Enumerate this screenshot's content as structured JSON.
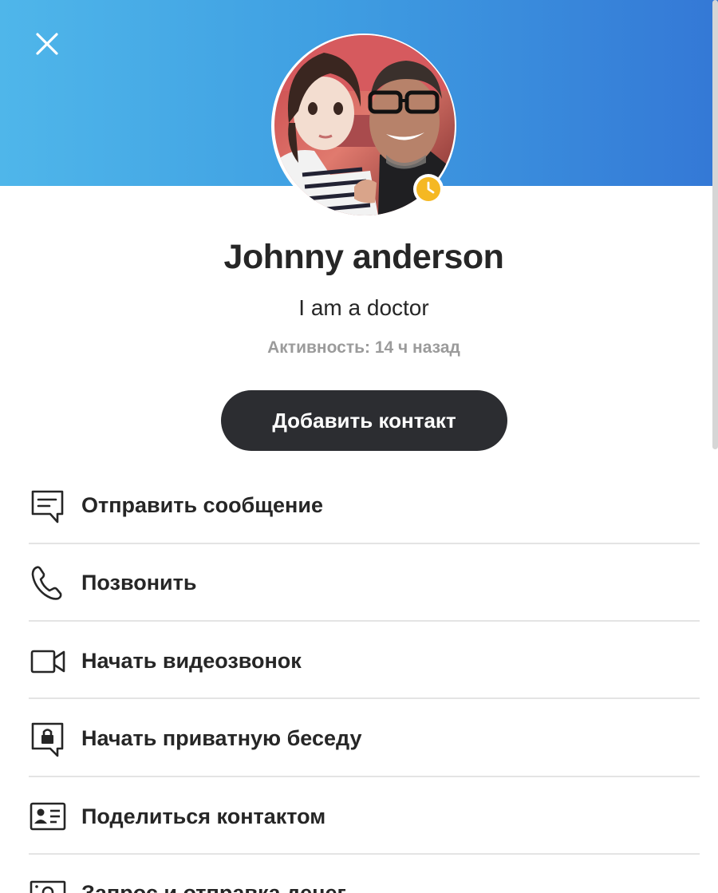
{
  "profile": {
    "name": "Johnny anderson",
    "mood": "I am a doctor",
    "activity": "Активность: 14 ч назад",
    "status_icon": "clock-icon",
    "status_color": "#f5b823"
  },
  "header": {
    "close_icon": "close-icon",
    "gradient_start": "#4fb6ea",
    "gradient_end": "#3478d6"
  },
  "actions": {
    "add_contact_label": "Добавить контакт",
    "add_contact_color": "#2c2d31"
  },
  "menu": [
    {
      "icon": "message-icon",
      "label": "Отправить сообщение"
    },
    {
      "icon": "phone-icon",
      "label": "Позвонить"
    },
    {
      "icon": "video-camera-icon",
      "label": "Начать видеозвонок"
    },
    {
      "icon": "private-lock-icon",
      "label": "Начать приватную беседу"
    },
    {
      "icon": "contact-card-icon",
      "label": "Поделиться контактом"
    },
    {
      "icon": "money-icon",
      "label": "Запрос и отправка денег"
    }
  ]
}
